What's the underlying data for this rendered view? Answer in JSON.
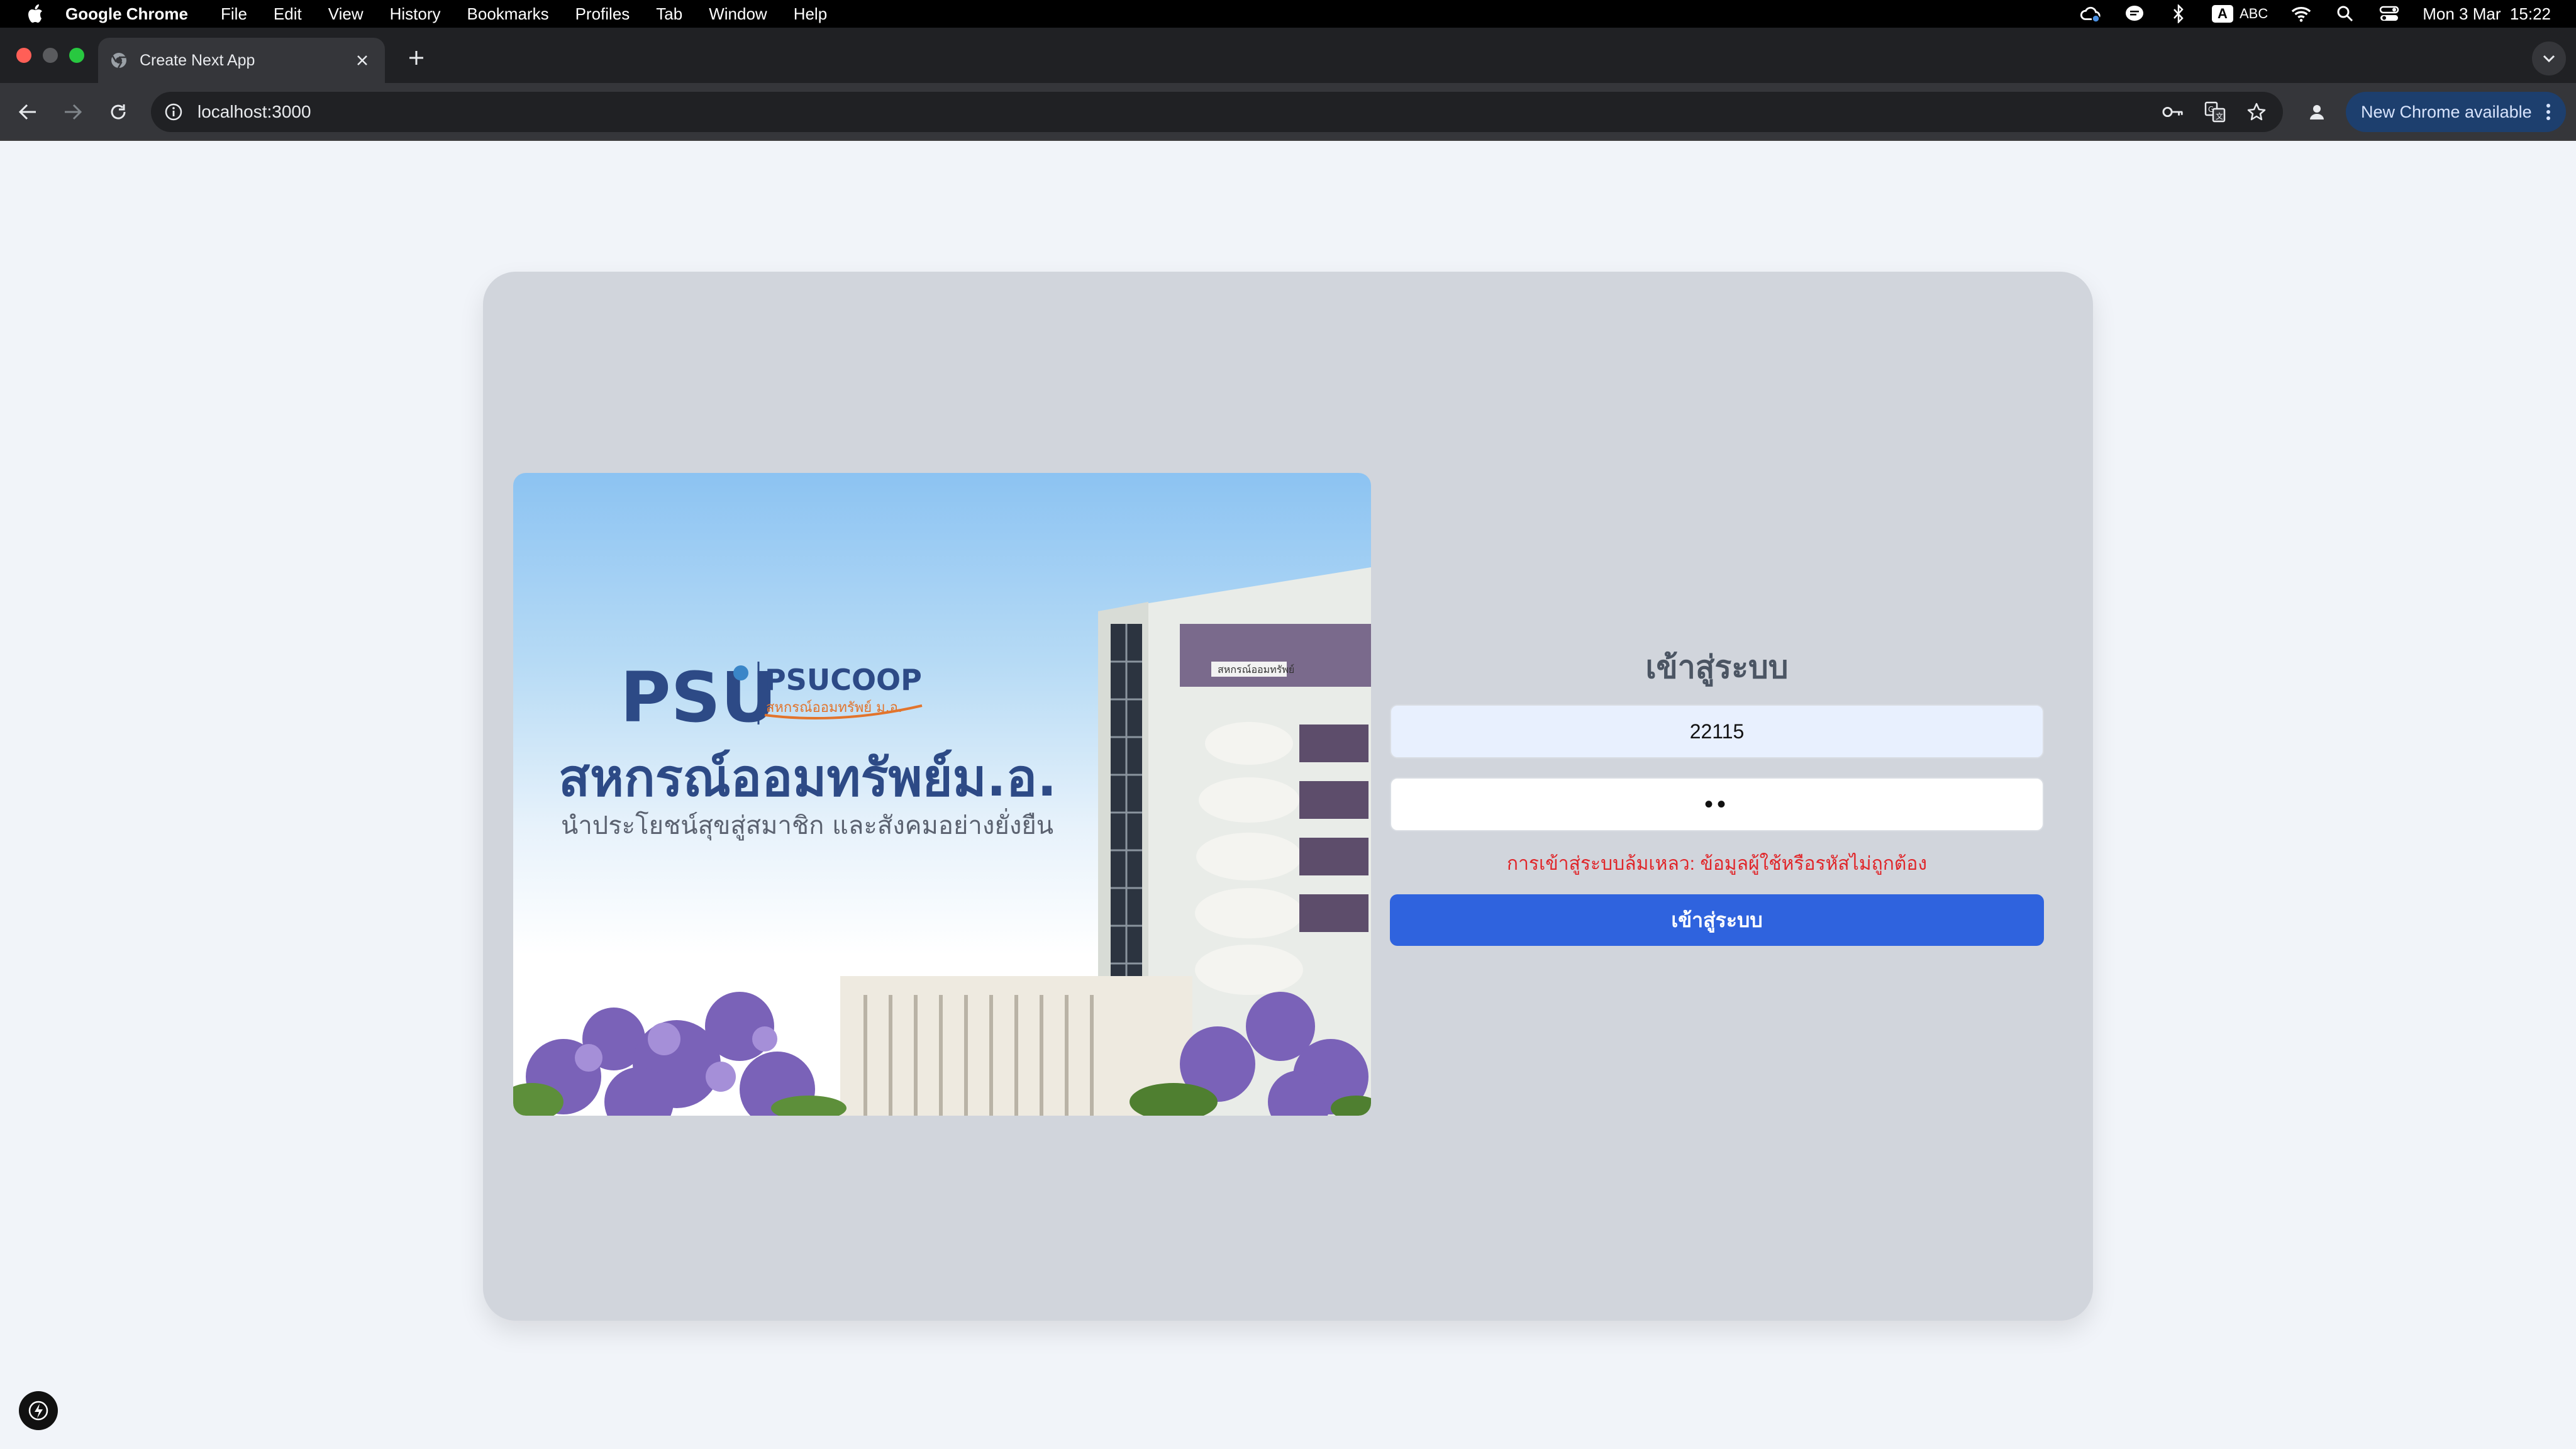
{
  "menubar": {
    "app_name": "Google Chrome",
    "items": [
      "File",
      "Edit",
      "View",
      "History",
      "Bookmarks",
      "Profiles",
      "Tab",
      "Window",
      "Help"
    ],
    "input_source": "ABC",
    "input_badge": "A",
    "datetime": "Mon 3 Mar  15:22"
  },
  "browser": {
    "tab_title": "Create Next App",
    "url": "localhost:3000",
    "update_label": "New Chrome available"
  },
  "banner": {
    "logo_psu": "PSU",
    "logo_coop": "PSUCOOP",
    "logo_sub": "สหกรณ์ออมทรัพย์ ม.อ.",
    "heading": "สหกรณ์ออมทรัพย์ม.อ.",
    "slogan": "นำประโยชน์สุขสู่สมาชิก และสังคมอย่างยั่งยืน",
    "building_sign": "สหกรณ์ออมทรัพย์"
  },
  "login": {
    "title": "เข้าสู่ระบบ",
    "username_value": "22115",
    "password_mask": "••",
    "error": "การเข้าสู่ระบบล้มเหลว: ข้อมูลผู้ใช้หรือรหัสไม่ถูกต้อง",
    "submit_label": "เข้าสู่ระบบ"
  },
  "colors": {
    "primary": "#2f63de",
    "error": "#e0262a",
    "card_bg": "#d1d5dc",
    "page_bg": "#f1f4f9"
  },
  "icons": [
    "apple-icon",
    "creative-cloud-icon",
    "chat-icon",
    "bluetooth-icon",
    "wifi-icon",
    "spotlight-icon",
    "control-center-icon",
    "chrome-tab-favicon",
    "close-icon",
    "plus-icon",
    "chevron-down-icon",
    "back-icon",
    "forward-icon",
    "reload-icon",
    "info-icon",
    "password-key-icon",
    "translate-icon",
    "star-icon",
    "profile-icon",
    "more-vert-icon",
    "nextjs-indicator-icon"
  ]
}
